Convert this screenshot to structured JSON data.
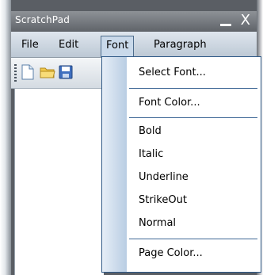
{
  "window": {
    "title": "ScratchPad",
    "close_glyph": "X"
  },
  "menubar": {
    "items": [
      {
        "label": "File"
      },
      {
        "label": "Edit"
      },
      {
        "label": "Font"
      },
      {
        "label": "Paragraph"
      }
    ],
    "active": "Font"
  },
  "toolbar": {
    "buttons": [
      {
        "icon": "new-document-icon"
      },
      {
        "icon": "open-folder-icon"
      },
      {
        "icon": "save-icon"
      }
    ]
  },
  "font_menu": {
    "items": [
      {
        "label": "Select Font..."
      },
      {
        "label": "Font Color..."
      },
      {
        "label": "Bold"
      },
      {
        "label": "Italic"
      },
      {
        "label": "Underline"
      },
      {
        "label": "StrikeOut"
      },
      {
        "label": "Normal"
      },
      {
        "label": "Page Color..."
      }
    ]
  },
  "colors": {
    "menu_border": "#315a87",
    "separator": "#3f6896",
    "titlebar": "#6e7378"
  }
}
